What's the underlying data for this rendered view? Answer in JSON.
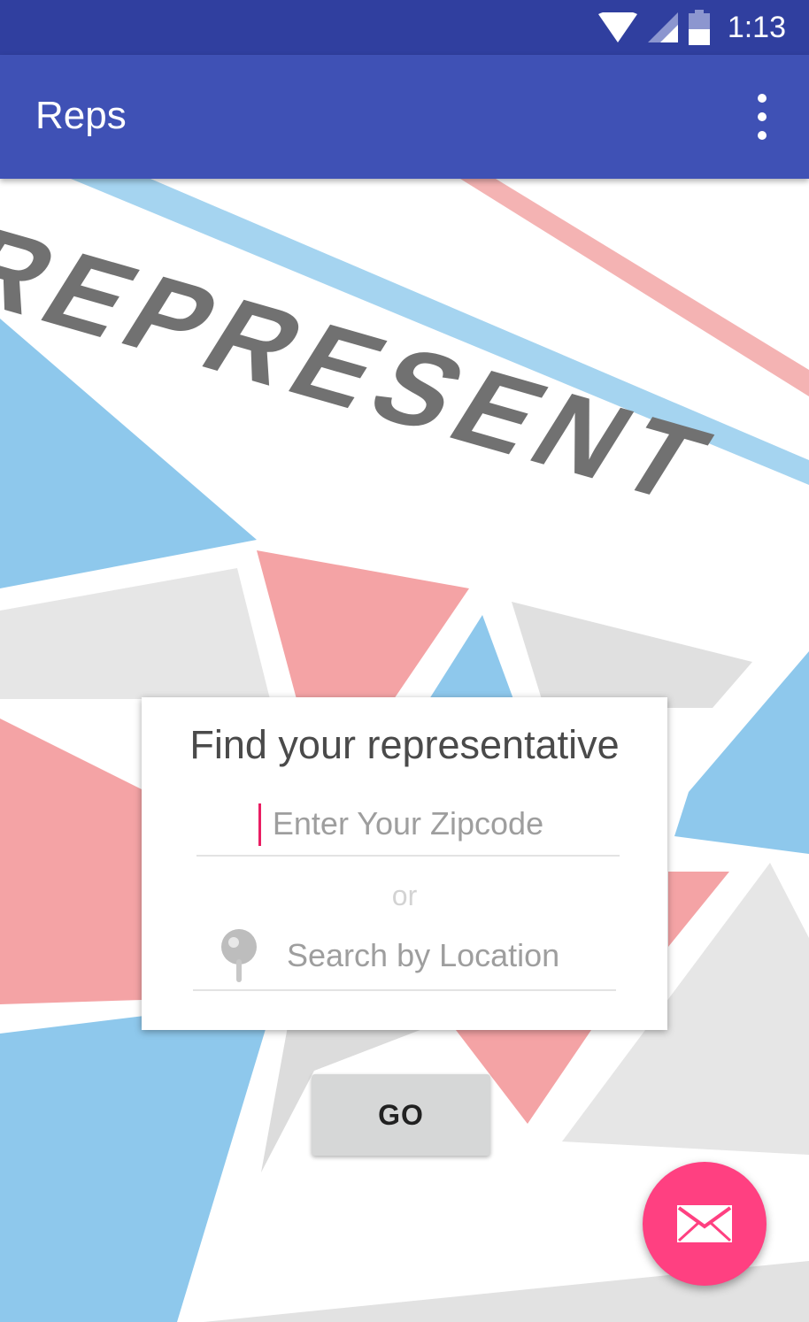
{
  "status_bar": {
    "time": "1:13",
    "icons": [
      "wifi-icon",
      "cell-signal-icon",
      "battery-icon"
    ]
  },
  "app_bar": {
    "title": "Reps",
    "overflow_icon": "more-vert-icon"
  },
  "banner": {
    "logo_text": "REPRESENT"
  },
  "search_card": {
    "title": "Find your representative",
    "zipcode": {
      "value": "",
      "placeholder": "Enter Your Zipcode"
    },
    "separator": "or",
    "location": {
      "value": "",
      "placeholder": "Search by Location",
      "icon": "location-pin-icon"
    }
  },
  "go_button": {
    "label": "GO"
  },
  "fab": {
    "icon": "mail-icon"
  },
  "colors": {
    "status_bar": "#303f9f",
    "app_bar": "#3f51b5",
    "accent": "#ff4081",
    "shape_blue": "#8ec8ec",
    "shape_pink": "#f4a3a5",
    "shape_gray": "#e6e6e6",
    "logo_text": "#717171"
  }
}
